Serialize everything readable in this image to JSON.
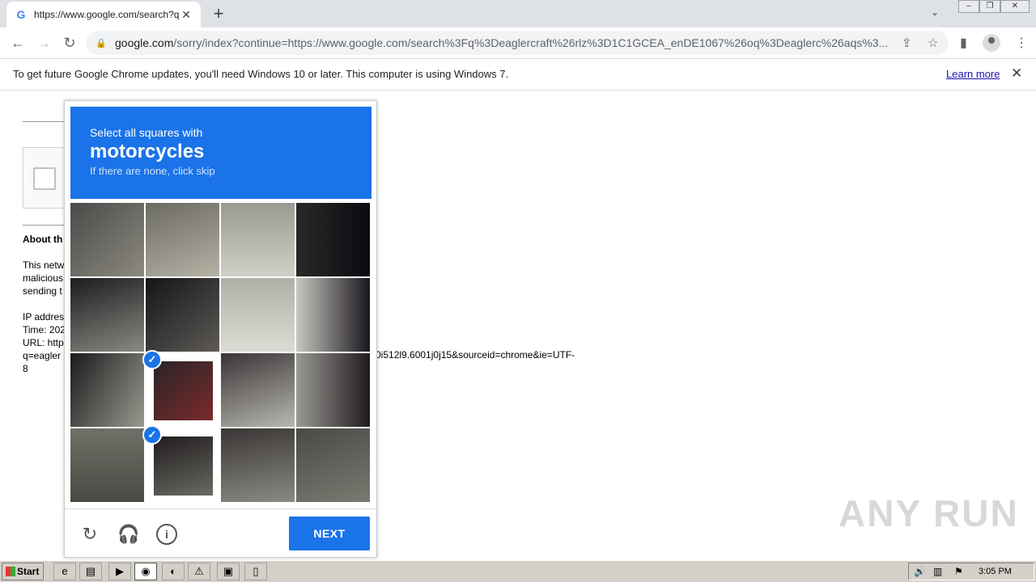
{
  "browser": {
    "tab_title": "https://www.google.com/search?q=",
    "tab_favicon": "G",
    "url_domain": "google.com",
    "url_path": "/sorry/index?continue=https://www.google.com/search%3Fq%3Deaglercraft%26rlz%3D1C1GCEA_enDE1067%26oq%3Deaglerc%26aqs%3..."
  },
  "infobar": {
    "message": "To get future Google Chrome updates, you'll need Windows 10 or later. This computer is using Windows 7.",
    "learn_more": "Learn more"
  },
  "page": {
    "about_heading": "About th",
    "para_lines": [
      "This netw",
      "malicious",
      "sending t"
    ],
    "info_lines": [
      "IP addres",
      "Time: 202",
      "URL: http",
      "q=eagler",
      "8"
    ],
    "url_tail": "0i512l9.6001j0j15&sourceid=chrome&ie=UTF-"
  },
  "challenge": {
    "instruction": "Select all squares with",
    "target": "motorcycles",
    "hint": "If there are none, click skip",
    "next_label": "NEXT",
    "selected_cells": [
      9,
      13
    ]
  },
  "taskbar": {
    "start_label": "Start",
    "clock": "3:05 PM"
  },
  "watermark": "ANY RUN"
}
